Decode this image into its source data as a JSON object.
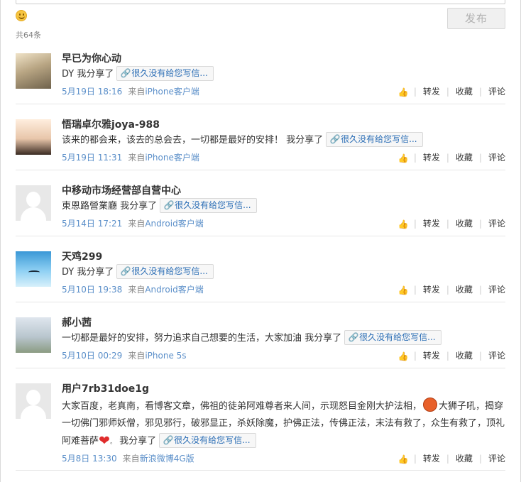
{
  "composer": {
    "emoji_icon": "smile-emoji-icon",
    "publish_label": "发布",
    "count_label": "共64条"
  },
  "actions": {
    "like_icon": "thumbs-up-icon",
    "repost": "转发",
    "favorite": "收藏",
    "comment": "评论"
  },
  "posts": [
    {
      "name": "早已为你心动",
      "text": "DY 我分享了",
      "link_label": "很久没有给您写信...",
      "date": "5月19日 18:16",
      "source_prefix": "来自",
      "source": "iPhone客户端"
    },
    {
      "name": "悟瑞卓尔雅joya-988",
      "text": "该来的都会来，该去的总会去，一切都是最好的安排！ 我分享了",
      "link_label": "很久没有给您写信...",
      "date": "5月19日 11:31",
      "source_prefix": "来自",
      "source": "iPhone客户端"
    },
    {
      "name": "中移动市场经营部自营中心",
      "text": "東恩路營業廳 我分享了",
      "link_label": "很久没有给您写信...",
      "date": "5月14日 17:21",
      "source_prefix": "来自",
      "source": "Android客户端"
    },
    {
      "name": "天鸡299",
      "text": "DY 我分享了",
      "link_label": "很久没有给您写信...",
      "date": "5月10日 19:38",
      "source_prefix": "来自",
      "source": "Android客户端"
    },
    {
      "name": "郝小茜",
      "text": "一切都是最好的安排，努力追求自己想要的生活，大家加油 我分享了",
      "link_label": "很久没有给您写信...",
      "date": "5月10日 00:29",
      "source_prefix": "来自",
      "source": "iPhone 5s"
    },
    {
      "name": "用户7rb31doe1g",
      "text_a": "大家百度，老真南，看博客文章，佛祖的徒弟阿难尊者来人间，示现怒目金刚大护法相，",
      "text_b": "大狮子吼，揭穿一切佛门邪师妖僧，邪见邪行，破邪显正，杀妖除魔，护佛正法，传佛正法，末法有救了，众生有救了，顶礼阿难菩萨",
      "text_c": "我分享了",
      "face_icon": "angry-face-emoji-icon",
      "heart_icon": "heart-emoji-icon",
      "link_label": "很久没有给您写信...",
      "date": "5月8日 13:30",
      "source_prefix": "来自",
      "source": "新浪微博4G版"
    }
  ]
}
